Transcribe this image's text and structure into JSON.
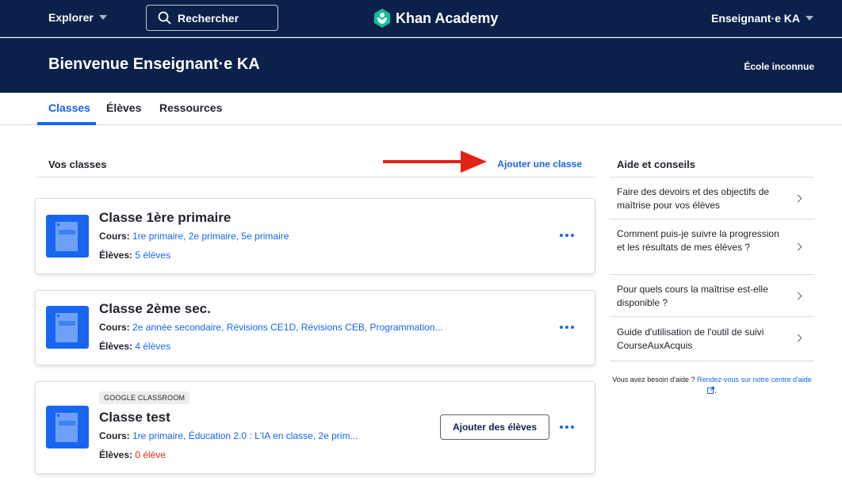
{
  "nav": {
    "explore_label": "Explorer",
    "search_label": "Rechercher",
    "logo_text": "Khan Academy",
    "user_label": "Enseignant·e KA"
  },
  "header": {
    "welcome": "Bienvenue Enseignant·e KA",
    "school": "École inconnue"
  },
  "tabs": [
    {
      "label": "Classes",
      "active": true
    },
    {
      "label": "Élèves",
      "active": false
    },
    {
      "label": "Ressources",
      "active": false
    }
  ],
  "classes_section": {
    "title": "Vos classes",
    "add_class_label": "Ajouter une classe"
  },
  "classes": [
    {
      "name": "Classe 1ère primaire",
      "courses_label": "Cours:",
      "courses": "1re primaire, 2e primaire, 5e primaire",
      "students_label": "Élèves:",
      "students": "5 élèves"
    },
    {
      "name": "Classe 2ème sec.",
      "courses_label": "Cours:",
      "courses": "2e année secondaire, Révisions CE1D, Révisions CEB, Programmation...",
      "students_label": "Élèves:",
      "students": "4 élèves"
    },
    {
      "badge": "GOOGLE CLASSROOM",
      "name": "Classe test",
      "courses_label": "Cours:",
      "courses": "1re primaire, Éducation 2.0 : L'IA en classe, 2e prim...",
      "students_label": "Élèves:",
      "students": "0 élève",
      "add_students_label": "Ajouter des élèves"
    }
  ],
  "sidebar": {
    "title": "Aide et conseils",
    "items": [
      {
        "label": "Faire des devoirs et des objectifs de maîtrise pour vos élèves"
      },
      {
        "label": "Comment puis-je suivre la progression et les résultats de mes élèves ?"
      },
      {
        "label": "Pour quels cours la maîtrise est-elle disponible ?"
      },
      {
        "label": "Guide d'utilisation de l'outil de suivi CourseAuxAcquis"
      }
    ],
    "help_prefix": "Vous avez besoin d'aide ?",
    "help_link": "Rendez-vous sur notre centre d'aide",
    "help_suffix": "."
  },
  "colors": {
    "navy": "#0b2149",
    "blue": "#1865f2",
    "red": "#d92916",
    "logo_green": "#14bf96"
  }
}
